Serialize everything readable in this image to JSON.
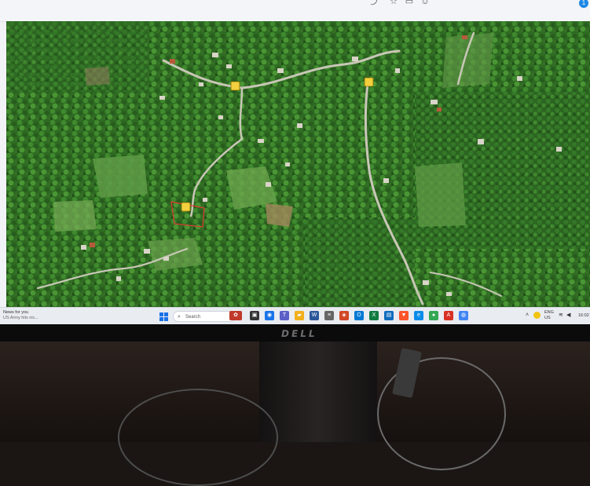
{
  "screen": {
    "badge": "1"
  },
  "map": {
    "type": "satellite",
    "markers": [
      {
        "name": "marker-north-west"
      },
      {
        "name": "marker-north-east"
      },
      {
        "name": "marker-plot"
      }
    ]
  },
  "taskbar": {
    "news_title": "News for you",
    "news_sub": "US Army hits nic...",
    "search_placeholder": "Search",
    "lang": "ENG",
    "lang_sub": "US",
    "clock": "16:02"
  },
  "monitor": {
    "brand": "DELL"
  },
  "colors": {
    "vegetation": "#2f6d24",
    "road": "#c9c7b7",
    "marker": "#f4d03f",
    "taskbar": "#e9ecf1",
    "bezel": "#0b0b0c"
  }
}
